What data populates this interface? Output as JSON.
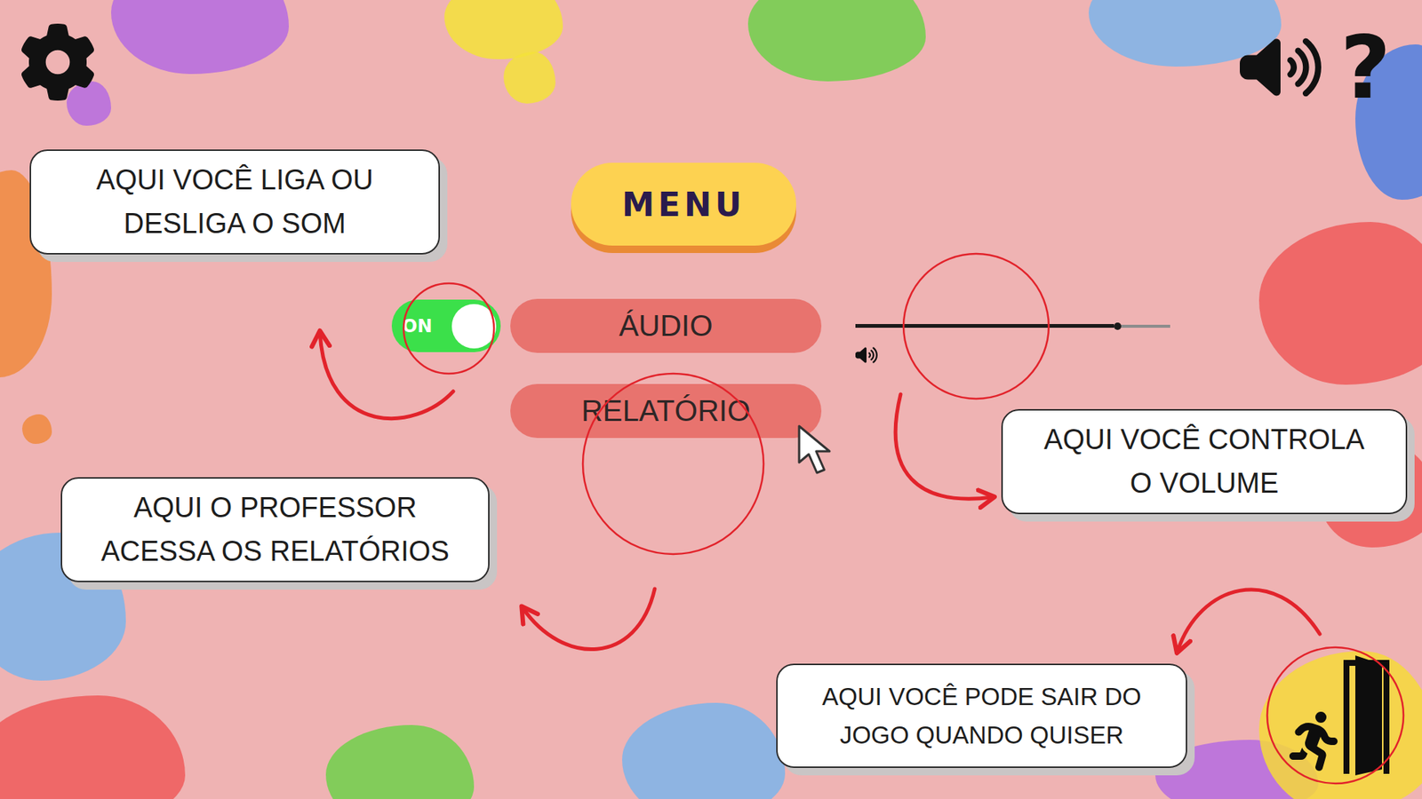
{
  "toolbar": {
    "help": "?"
  },
  "menu": {
    "title": "MENU"
  },
  "sound_toggle": {
    "label": "ON",
    "on": true
  },
  "options": [
    {
      "label": "ÁUDIO",
      "kind": "audio"
    },
    {
      "label": "RELATÓRIO",
      "kind": "report"
    }
  ],
  "volume": {
    "level": 0.82
  },
  "callouts": {
    "sound": [
      "AQUI VOCÊ LIGA OU",
      "DESLIGA O SOM"
    ],
    "volume": [
      "AQUI VOCÊ CONTROLA",
      "O VOLUME"
    ],
    "report": [
      "AQUI O PROFESSOR",
      "ACESSA OS RELATÓRIOS"
    ],
    "exit": [
      "AQUI VOCÊ PODE SAIR DO",
      "JOGO QUANDO QUISER"
    ]
  }
}
